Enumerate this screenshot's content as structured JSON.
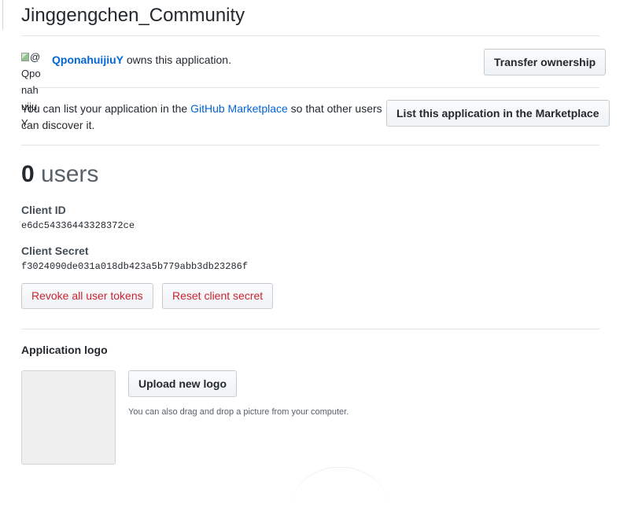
{
  "app": {
    "title": "Jinggengchen_Community"
  },
  "owner": {
    "avatar_alt": "@Qponahuijiuy",
    "avatar_alt_lines": [
      "@",
      "Qpo",
      "nah",
      "uiju",
      "Y"
    ],
    "name": "QponahuijiuY",
    "suffix": " owns this application.",
    "transfer_label": "Transfer ownership"
  },
  "marketplace": {
    "text_before": "You can list your application in the ",
    "link": "GitHub Marketplace",
    "text_after": " so that other users can discover it.",
    "button_label": "List this application in the Marketplace"
  },
  "users": {
    "count": "0",
    "label": " users"
  },
  "credentials": {
    "client_id_label": "Client ID",
    "client_id": "e6dc54336443328372ce",
    "client_secret_label": "Client Secret",
    "client_secret": "f3024090de031a018db423a5b779abb3db23286f",
    "revoke_label": "Revoke all user tokens",
    "reset_label": "Reset client secret"
  },
  "logo": {
    "section_title": "Application logo",
    "upload_label": "Upload new logo",
    "hint": "You can also drag and drop a picture from your computer."
  },
  "colors": {
    "link": "#0366d6",
    "danger": "#cb2431",
    "border": "#e1e4e8"
  }
}
